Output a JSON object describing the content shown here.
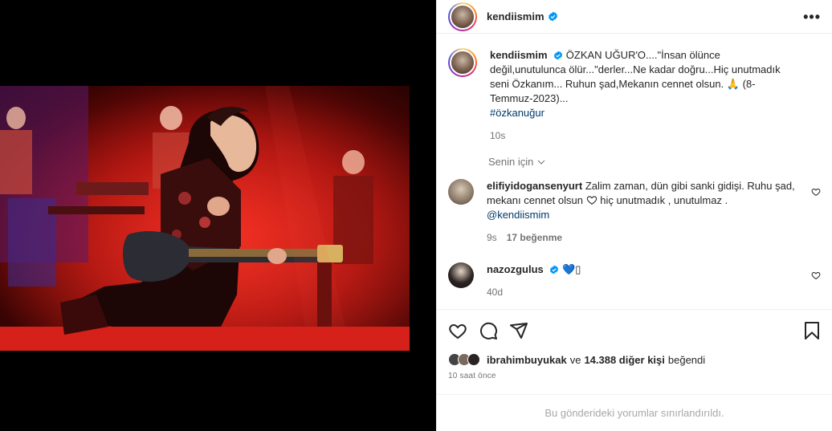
{
  "post": {
    "author": "kendiismim",
    "caption": "ÖZKAN UĞUR'O....\"İnsan ölünce değil,unutulunca ölür...\"derler...Ne kadar doğru...Hiç unutmadık seni Özkanım... Ruhun şad,Mekanın cennet olsun.",
    "caption_emoji": "🙏",
    "caption_tail": "(8-Temmuz-2023)...",
    "hashtag": "#özkanuğur",
    "caption_time": "10s"
  },
  "sort_label": "Senin için",
  "comments": [
    {
      "user": "elifiyidogansenyurt",
      "text": "Zalim zaman, dün gibi sanki gidişi. Ruhu şad, mekanı cennet olsun",
      "text_tail": "hiç unutmadık , unutulmaz .",
      "mention": "@kendiismim",
      "time": "9s",
      "likes": "17 beğenme"
    },
    {
      "user": "nazozgulus",
      "text": "💙",
      "text_tail": "▯",
      "time": "40d"
    }
  ],
  "liked_by": {
    "user": "ibrahimbuyukak",
    "connector": "ve",
    "others": "14.388 diğer kişi",
    "suffix": "beğendi"
  },
  "posted_ago": "10 saat önce",
  "comments_limited": "Bu gönderideki yorumlar sınırlandırıldı.",
  "icons": [
    "more-icon",
    "verified-icon",
    "heart-icon",
    "comment-icon",
    "share-icon",
    "bookmark-icon",
    "chevron-down-icon"
  ],
  "colors": {
    "verified": "#0095f6",
    "link": "#00376b",
    "muted": "#737373",
    "blue_heart": "#1877f2"
  }
}
